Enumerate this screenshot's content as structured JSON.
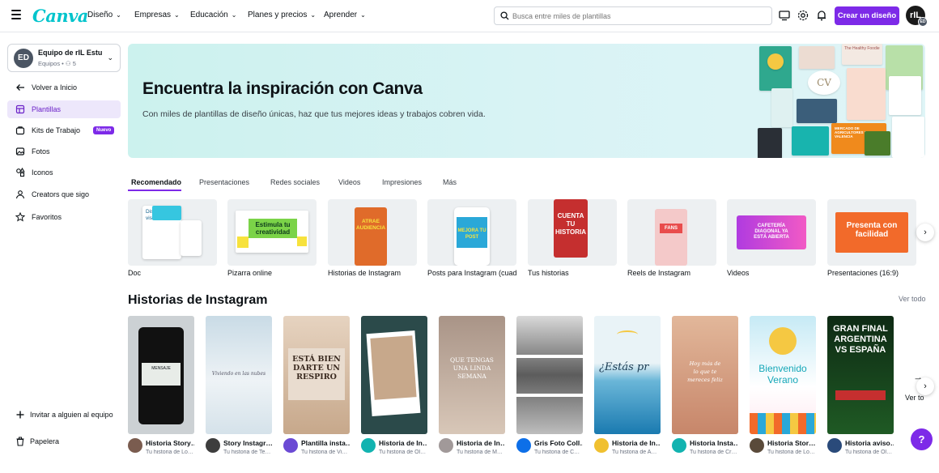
{
  "brand": {
    "logo": "Canva",
    "accent": "#7d2ae8",
    "logo_color": "#00c4cc"
  },
  "nav": [
    "Diseño",
    "Empresas",
    "Educación",
    "Planes y precios",
    "Aprender"
  ],
  "search": {
    "placeholder": "Busca entre miles de plantillas"
  },
  "header_actions": {
    "create_label": "Crear un diseño",
    "avatar_initials": "rIL",
    "avatar_badge": "ED",
    "icons": [
      "monitor-icon",
      "gear-icon",
      "bell-icon"
    ]
  },
  "sidebar": {
    "team": {
      "initials": "ED",
      "name": "Equipo de rIL Estu…",
      "sub": "Equipos • ",
      "members": "5"
    },
    "back": "Volver a Inicio",
    "items": [
      {
        "label": "Plantillas",
        "icon": "template-icon",
        "active": true
      },
      {
        "label": "Kits de Trabajo",
        "icon": "kit-icon",
        "badge": "Nuevo"
      },
      {
        "label": "Fotos",
        "icon": "photo-icon"
      },
      {
        "label": "Iconos",
        "icon": "shapes-icon"
      },
      {
        "label": "Creators que sigo",
        "icon": "creators-icon"
      },
      {
        "label": "Favoritos",
        "icon": "star-icon"
      }
    ],
    "invite": "Invitar a alguien al equipo",
    "trash": "Papelera"
  },
  "hero": {
    "title": "Encuentra la inspiración con Canva",
    "subtitle": "Con miles de plantillas de diseño únicas, haz que tus mejores ideas y trabajos cobren vida.",
    "collage_text": {
      "cv": "CV",
      "healthy": "The Healthy Foodie",
      "mercado": "MERCADO DE AGRICULTORES DE VALENCIA"
    }
  },
  "tabs": [
    {
      "label": "Recomendado",
      "active": true
    },
    {
      "label": "Presentaciones"
    },
    {
      "label": "Redes sociales"
    },
    {
      "label": "Videos"
    },
    {
      "label": "Impresiones"
    },
    {
      "label": "Más"
    }
  ],
  "categories": [
    {
      "label": "Doc",
      "thumb_text": "Diseña Docs visuales"
    },
    {
      "label": "Pizarra online",
      "thumb_text": "Estimula tu creatividad"
    },
    {
      "label": "Historias de Instagram",
      "thumb_text": "ATRAE AUDIENCIA"
    },
    {
      "label": "Posts para Instagram (cuadrado)",
      "thumb_text": "MEJORA TU POST"
    },
    {
      "label": "Tus historias",
      "thumb_text": "CUENTA TU HISTORIA"
    },
    {
      "label": "Reels de Instagram",
      "thumb_text": "FANS"
    },
    {
      "label": "Videos",
      "thumb_text": "CAFETERÍA DIAGONAL YA ESTÁ ABIERTA"
    },
    {
      "label": "Presentaciones (16:9)",
      "thumb_text": "Presenta con facilidad"
    }
  ],
  "section": {
    "title": "Historias de Instagram",
    "see_all": "Ver todo",
    "see_all_trailing": "Ver to"
  },
  "stories": [
    {
      "title": "Historia Story…",
      "subtitle": "Tu historia de Lo…",
      "thumb": "MENSAJE"
    },
    {
      "title": "Story Instagr…",
      "subtitle": "Tu historia de Te…",
      "thumb": "Viviendo en las nubes"
    },
    {
      "title": "Plantilla insta…",
      "subtitle": "Tu historia de Vi…",
      "thumb": "ESTÁ BIEN DARTE UN RESPIRO"
    },
    {
      "title": "Historia de In…",
      "subtitle": "Tu historia de Ol…",
      "thumb": ""
    },
    {
      "title": "Historia de In…",
      "subtitle": "Tu historia de M…",
      "thumb": "QUE TENGAS UNA LINDA SEMANA"
    },
    {
      "title": "Gris Foto Coll…",
      "subtitle": "Tu historia de C…",
      "thumb": ""
    },
    {
      "title": "Historia de In…",
      "subtitle": "Tu historia de A…",
      "thumb": "¿Estás pr"
    },
    {
      "title": "Historia Insta…",
      "subtitle": "Tu historia de Cr…",
      "thumb": "Hoy más de lo que te mereces feliz"
    },
    {
      "title": "Historia Stor…",
      "subtitle": "Tu historia de Lo…",
      "thumb": "Bienvenido Verano"
    },
    {
      "title": "Historia aviso…",
      "subtitle": "Tu historia de Ol…",
      "thumb": "GRAN FINAL ARGENTINA VS ESPAÑA"
    }
  ],
  "help": "?"
}
